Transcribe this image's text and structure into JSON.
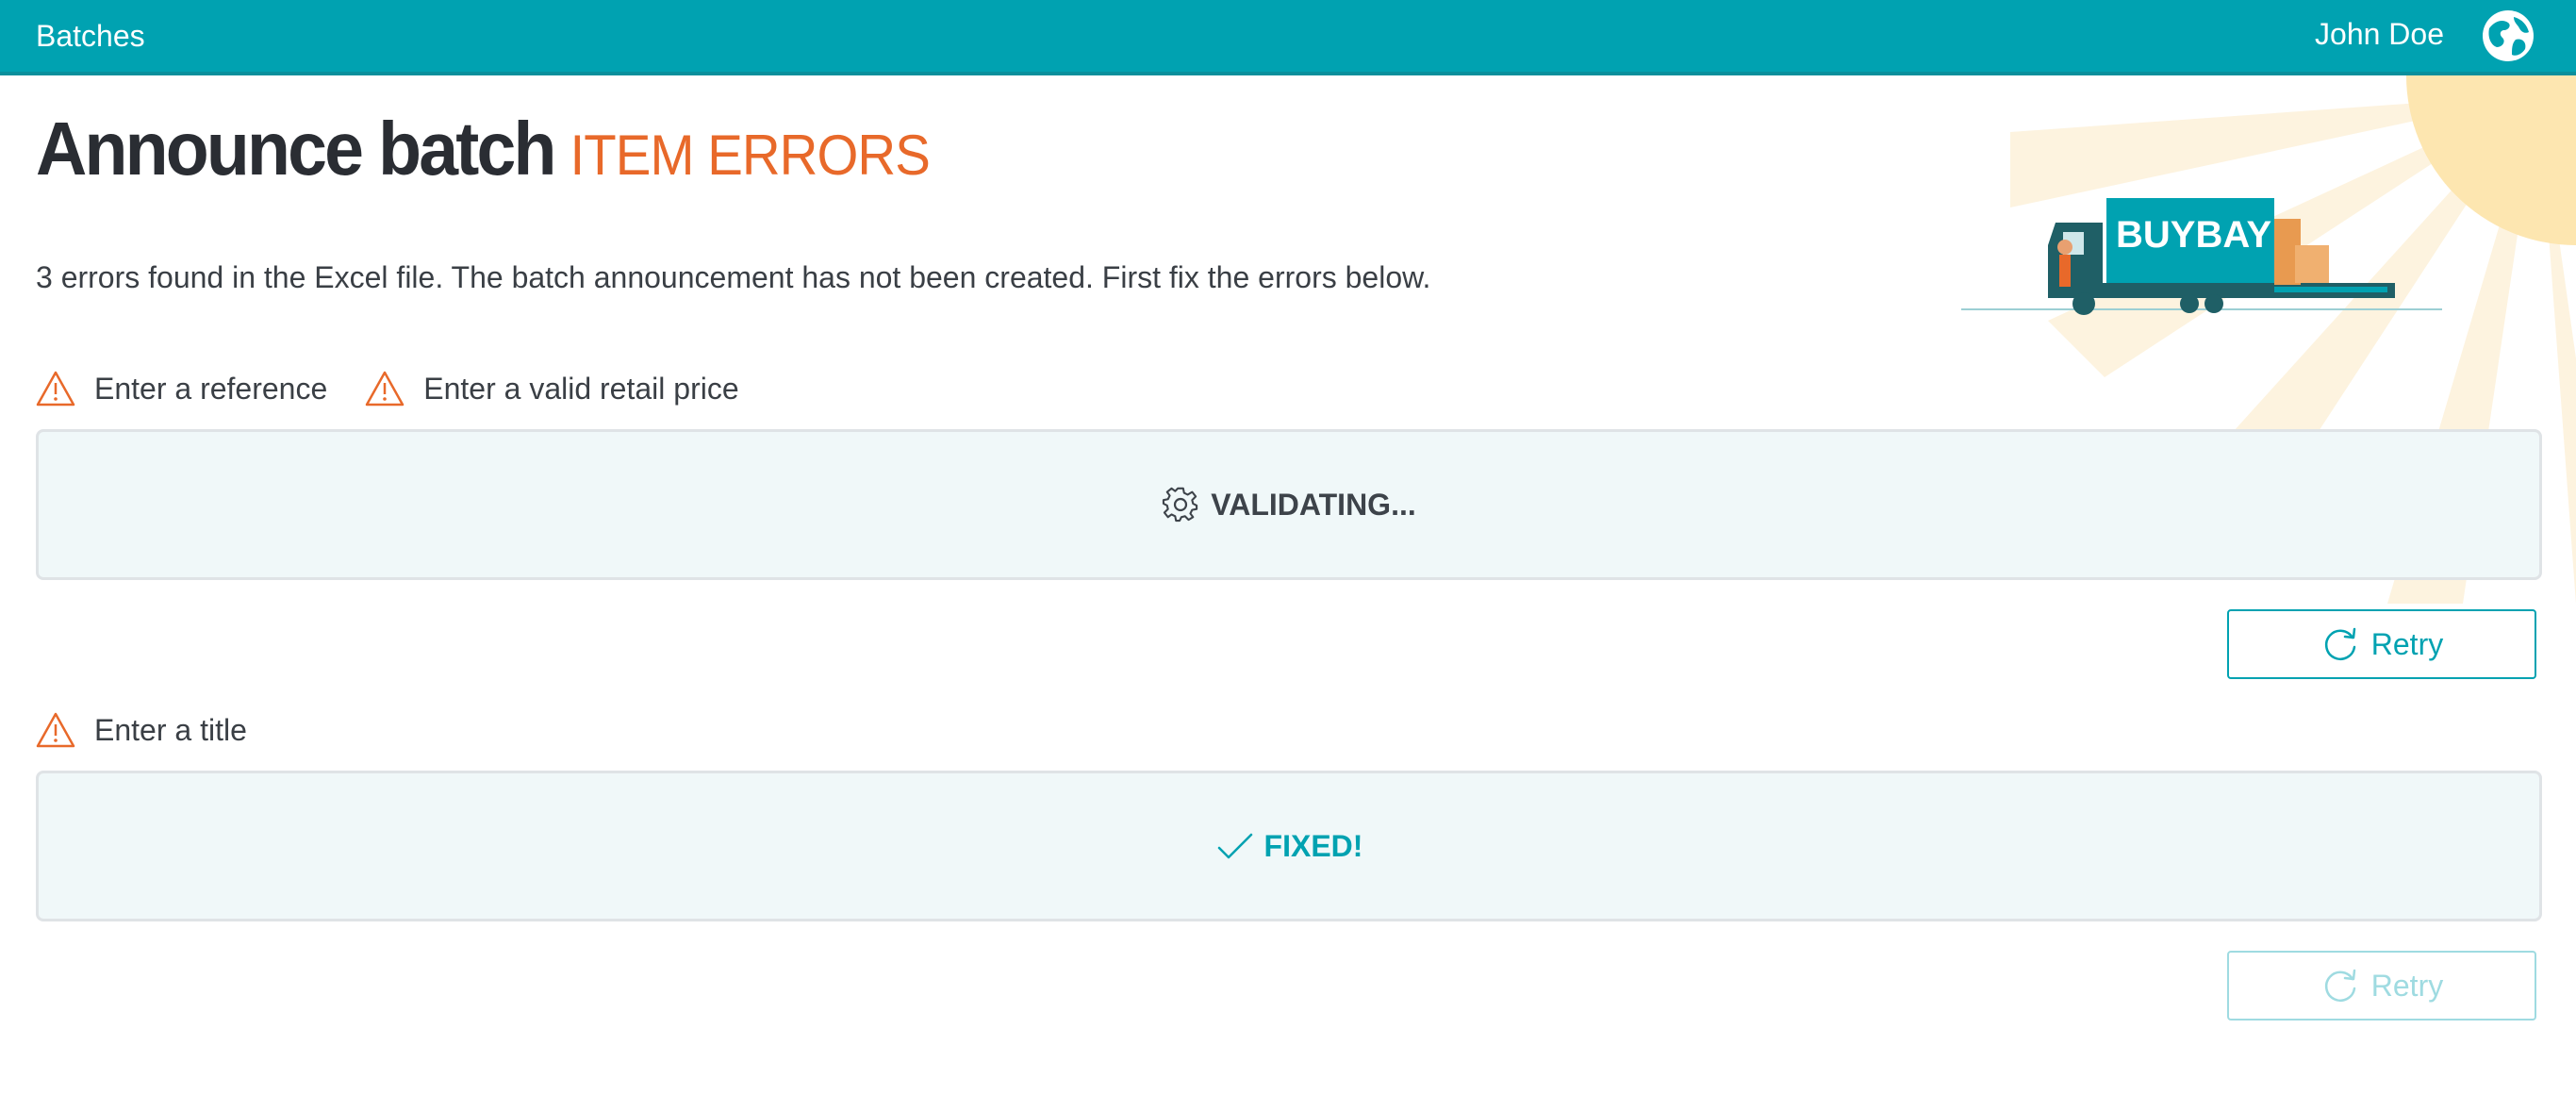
{
  "header": {
    "nav_label": "Batches",
    "user_name": "John Doe",
    "globe_icon": "globe-icon"
  },
  "page": {
    "title": "Announce batch",
    "subtitle": "ITEM ERRORS",
    "message": "3 errors found in the Excel file. The batch announcement has not been created. First fix the errors below.",
    "brand": "BUYBAY"
  },
  "error_groups": [
    {
      "errors": [
        "Enter a reference",
        "Enter a valid retail price"
      ],
      "status": "VALIDATING...",
      "status_icon": "gear-icon",
      "retry_label": "Retry",
      "retry_enabled": true
    },
    {
      "errors": [
        "Enter a title"
      ],
      "status": "FIXED!",
      "status_icon": "checkmark-icon",
      "retry_label": "Retry",
      "retry_enabled": false
    }
  ],
  "colors": {
    "header": "#00a2b1",
    "accent": "#00a2b1",
    "warning": "#e8692a",
    "panel_bg": "#f0f8f9"
  }
}
